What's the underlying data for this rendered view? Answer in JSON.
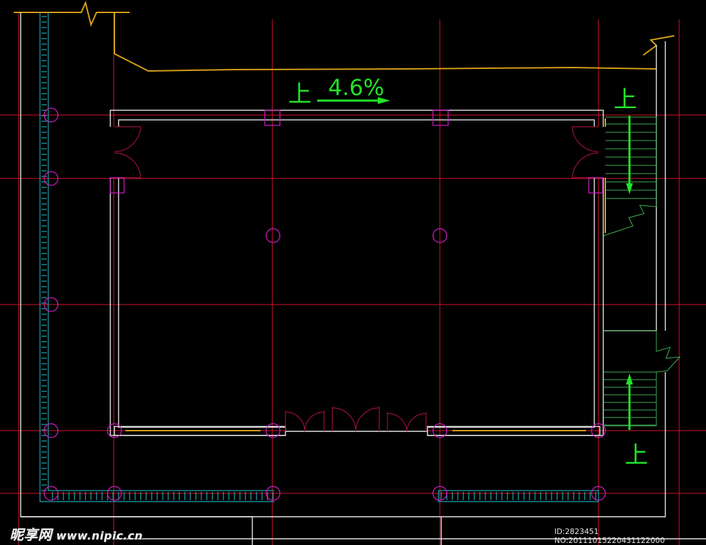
{
  "annotations": {
    "slope_up_label": "上",
    "slope_value": "4.6%",
    "stair_top_label": "上",
    "stair_bottom_label": "上"
  },
  "watermark": {
    "logo_text": "昵享网",
    "site_text": "www.nipic.cn"
  },
  "image_id": {
    "text": "ID:2823451 NO:20111015220431122000"
  },
  "colors": {
    "background": "#000000",
    "axis_grid": "#d8142c",
    "wall": "#e6e6e6",
    "drainage_teal": "#1fa7b4",
    "boundary_yellow": "#d4a017",
    "column_magenta": "#d21fc8",
    "door_darkred": "#9b1036",
    "annotation_green": "#22e32a"
  }
}
